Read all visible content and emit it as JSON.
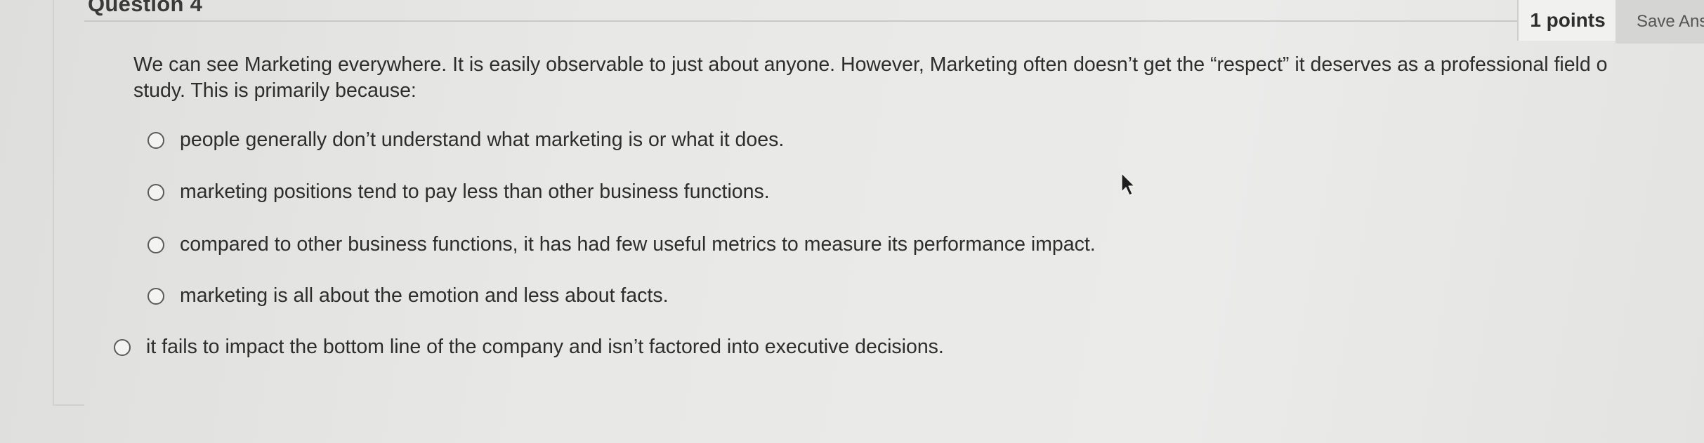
{
  "question": {
    "title": "Question 4",
    "points": "1 points",
    "save_label": "Save Ans",
    "prompt_line1": "We can see Marketing everywhere. It is easily observable to just about anyone. However, Marketing often doesn’t get the “respect” it deserves as a professional field o",
    "prompt_line2": "study. This is primarily because:",
    "options": [
      {
        "label": "people generally don’t understand what marketing is or what it does.",
        "selected": false
      },
      {
        "label": "marketing positions tend to pay less than other business functions.",
        "selected": false
      },
      {
        "label": "compared to other business functions, it has had few useful metrics to measure its performance impact.",
        "selected": false
      },
      {
        "label": "marketing is all about the emotion and less about facts.",
        "selected": false
      },
      {
        "label": "it fails to impact the bottom line of the company and isn’t factored into executive decisions.",
        "selected": false
      }
    ]
  },
  "colors": {
    "background": "#e8e8e6",
    "text": "#2d2d2d",
    "radio_border": "#5a5a5a",
    "save_button_bg": "#d5d5d3"
  },
  "icons": {
    "cursor": "mouse-pointer-icon",
    "radio": "radio-unchecked-icon"
  }
}
